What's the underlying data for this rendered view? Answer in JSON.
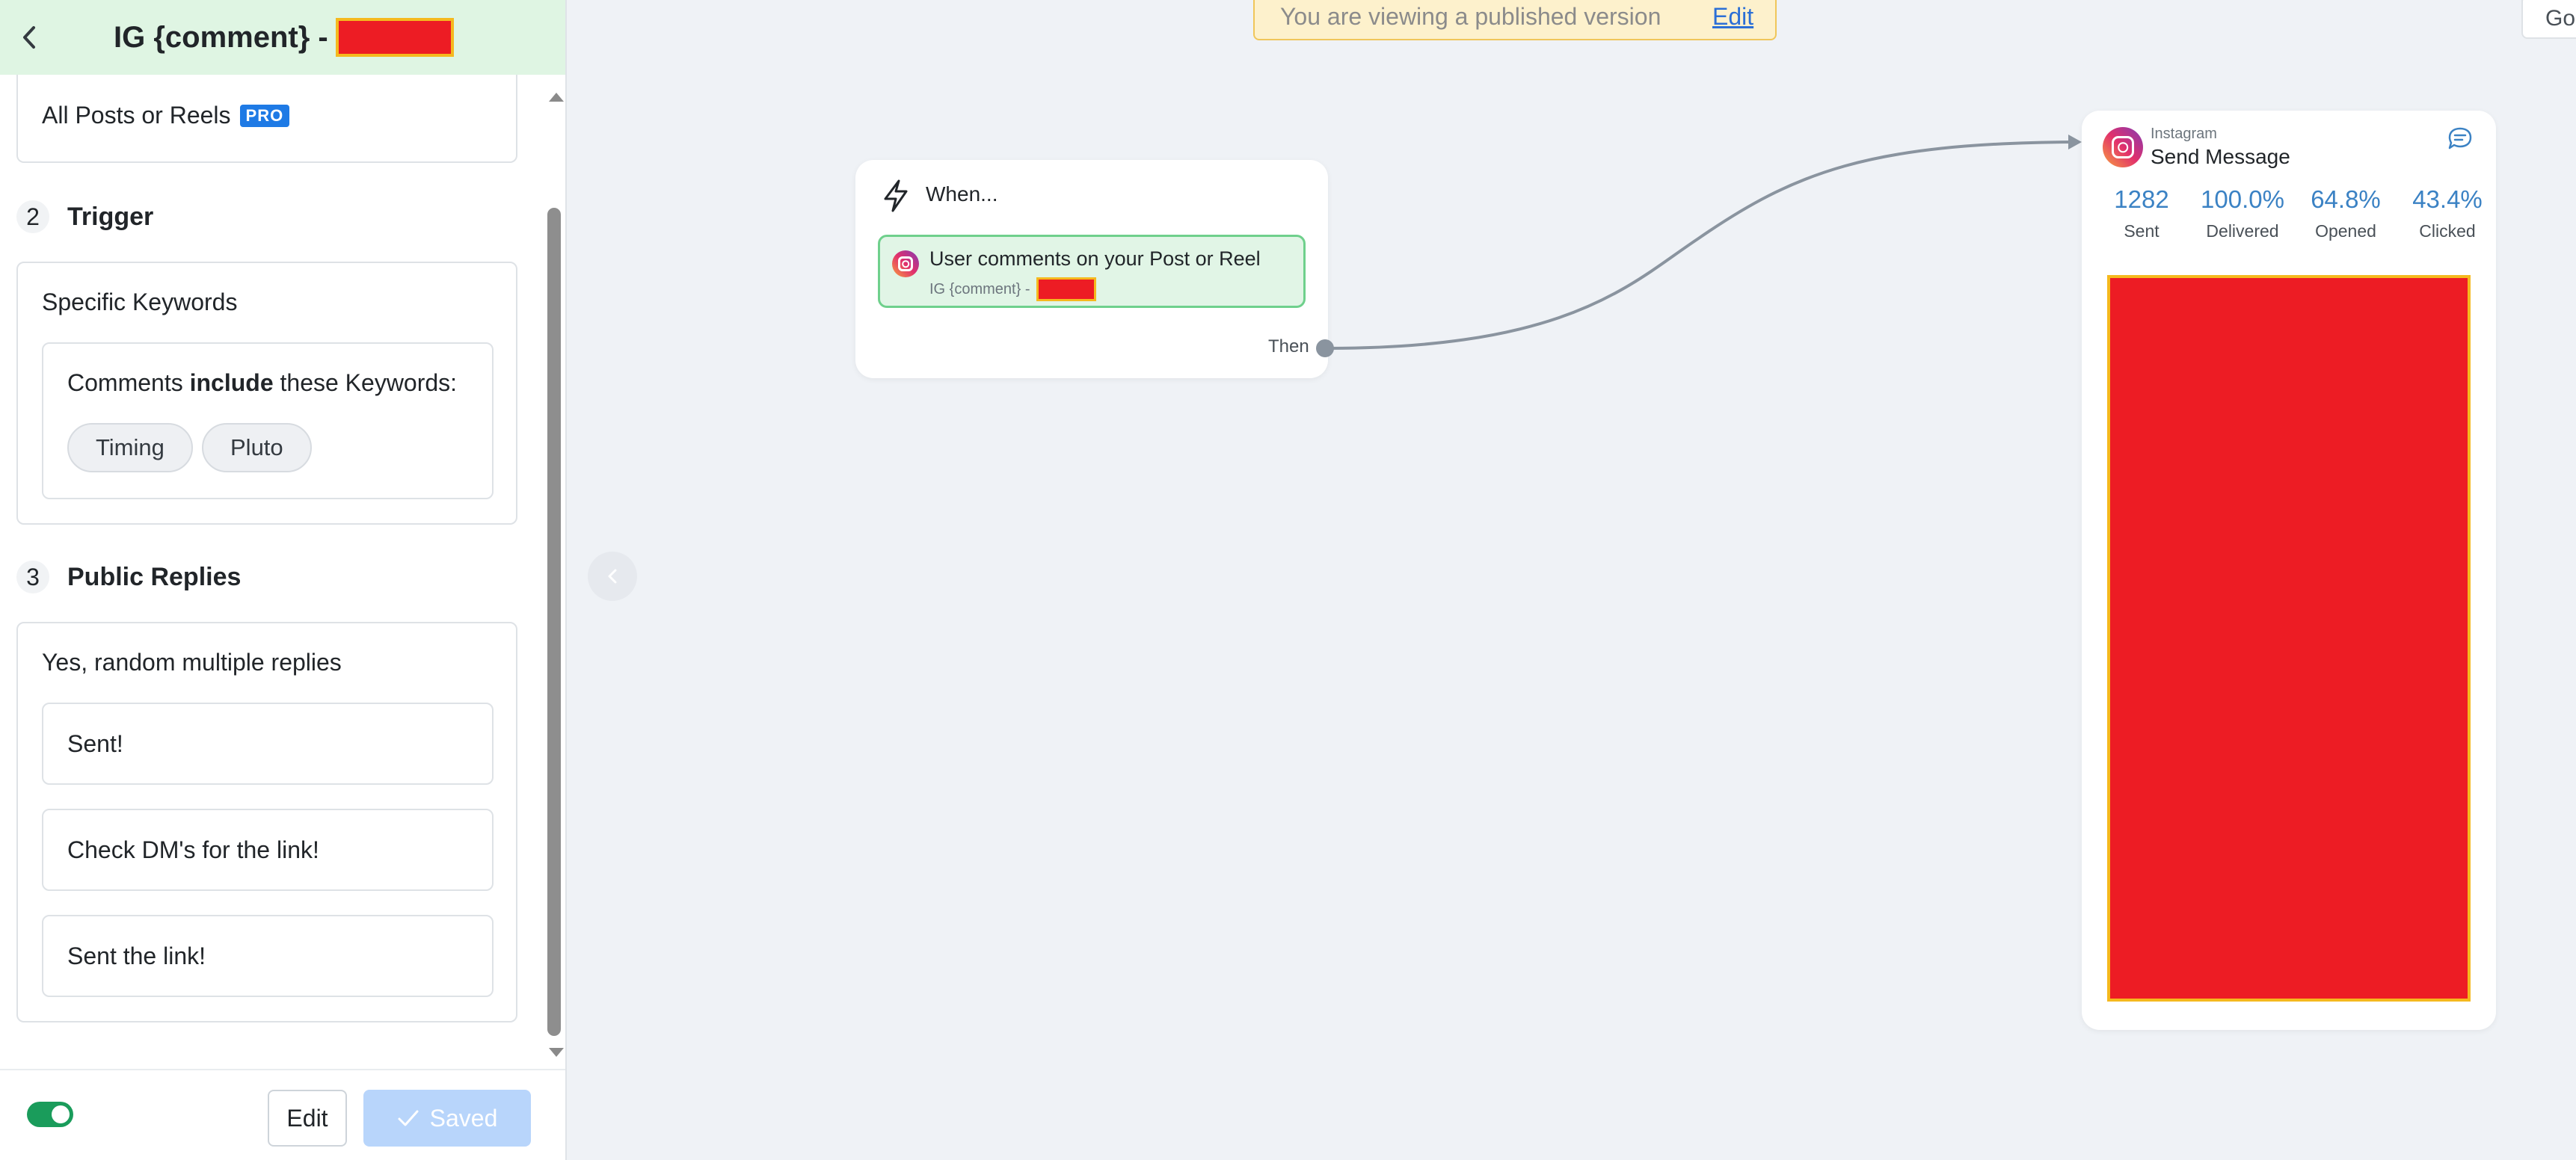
{
  "header": {
    "title": "IG {comment} -"
  },
  "config": {
    "post_scope": "All Posts or Reels",
    "pro_badge": "PRO"
  },
  "sections": [
    {
      "number": "2",
      "title": "Trigger"
    },
    {
      "number": "3",
      "title": "Public Replies"
    }
  ],
  "trigger": {
    "type": "Specific Keywords",
    "sentence_prefix": "Comments ",
    "sentence_bold": "include",
    "sentence_suffix": " these Keywords:",
    "keywords": [
      "Timing",
      "Pluto"
    ]
  },
  "public_replies": {
    "mode": "Yes, random multiple replies",
    "replies": [
      "Sent!",
      "Check DM's for the link!",
      "Sent the link!"
    ]
  },
  "footer": {
    "toggle_on": true,
    "edit_label": "Edit",
    "saved_label": "Saved"
  },
  "banner": {
    "text": "You are viewing a published version",
    "link": "Edit"
  },
  "top_right_button": "Go",
  "when_node": {
    "label": "When...",
    "trigger_title": "User comments on your Post or Reel",
    "trigger_subtitle": "IG {comment} -",
    "then_label": "Then"
  },
  "send_node": {
    "platform": "Instagram",
    "title": "Send Message",
    "stats": [
      {
        "value": "1282",
        "label": "Sent"
      },
      {
        "value": "100.0%",
        "label": "Delivered"
      },
      {
        "value": "64.8%",
        "label": "Opened"
      },
      {
        "value": "43.4%",
        "label": "Clicked"
      }
    ]
  },
  "colors": {
    "header_bg": "#dff5e3",
    "accent_green": "#1a9c5b",
    "stat_blue": "#3b82c4",
    "link_blue": "#2b6fd6",
    "redaction": "#ed1c24"
  }
}
